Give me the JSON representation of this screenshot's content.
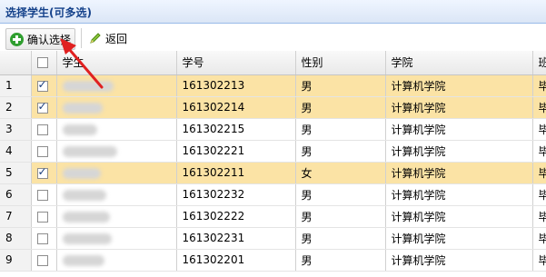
{
  "panel": {
    "title": "选择学生(可多选)"
  },
  "toolbar": {
    "confirm_label": "确认选择",
    "back_label": "返回"
  },
  "table": {
    "columns": [
      "学生",
      "学号",
      "性别",
      "学院",
      "班"
    ],
    "rows": [
      {
        "num": "1",
        "checked": true,
        "id": "161302213",
        "gender": "男",
        "college": "计算机学院",
        "cls": "毕"
      },
      {
        "num": "2",
        "checked": true,
        "id": "161302214",
        "gender": "男",
        "college": "计算机学院",
        "cls": "毕"
      },
      {
        "num": "3",
        "checked": false,
        "id": "161302215",
        "gender": "男",
        "college": "计算机学院",
        "cls": "毕"
      },
      {
        "num": "4",
        "checked": false,
        "id": "161302221",
        "gender": "男",
        "college": "计算机学院",
        "cls": "毕"
      },
      {
        "num": "5",
        "checked": true,
        "id": "161302211",
        "gender": "女",
        "college": "计算机学院",
        "cls": "毕"
      },
      {
        "num": "6",
        "checked": false,
        "id": "161302232",
        "gender": "男",
        "college": "计算机学院",
        "cls": "毕"
      },
      {
        "num": "7",
        "checked": false,
        "id": "161302222",
        "gender": "男",
        "college": "计算机学院",
        "cls": "毕"
      },
      {
        "num": "8",
        "checked": false,
        "id": "161302231",
        "gender": "男",
        "college": "计算机学院",
        "cls": "毕"
      },
      {
        "num": "9",
        "checked": false,
        "id": "161302201",
        "gender": "男",
        "college": "计算机学院",
        "cls": "毕"
      }
    ]
  },
  "colors": {
    "selected_row": "#fbe3a5",
    "annotation_arrow": "#e02020",
    "title_text": "#15428b"
  }
}
